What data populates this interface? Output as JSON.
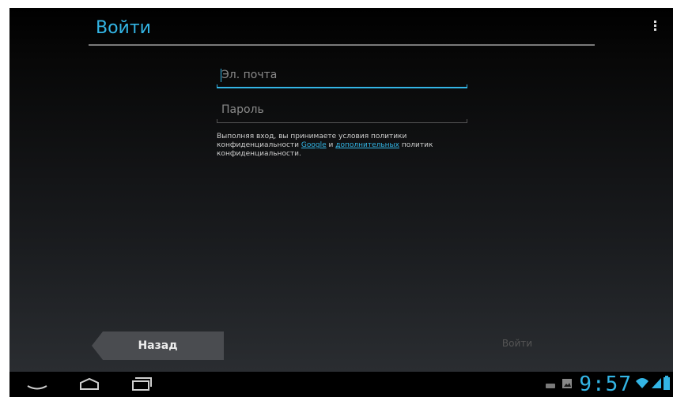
{
  "header": {
    "title": "Войти"
  },
  "form": {
    "email_placeholder": "Эл. почта",
    "password_placeholder": "Пароль",
    "terms_prefix": "Выполняя вход, вы принимаете условия политики конфиденциальности",
    "terms_link_google": "Google",
    "terms_and": "и",
    "terms_link_additional": "дополнительных",
    "terms_suffix": "политик конфиденциальности."
  },
  "buttons": {
    "back_label": "Назад",
    "signin_label": "Войти"
  },
  "status_bar": {
    "time": "9:57",
    "accent_color": "#33b5e5"
  },
  "icons": [
    "overflow-menu-icon",
    "nav-back-icon",
    "nav-home-icon",
    "nav-recent-apps-icon",
    "keyboard-icon",
    "image-notification-icon",
    "wifi-icon",
    "signal-icon",
    "battery-icon"
  ]
}
